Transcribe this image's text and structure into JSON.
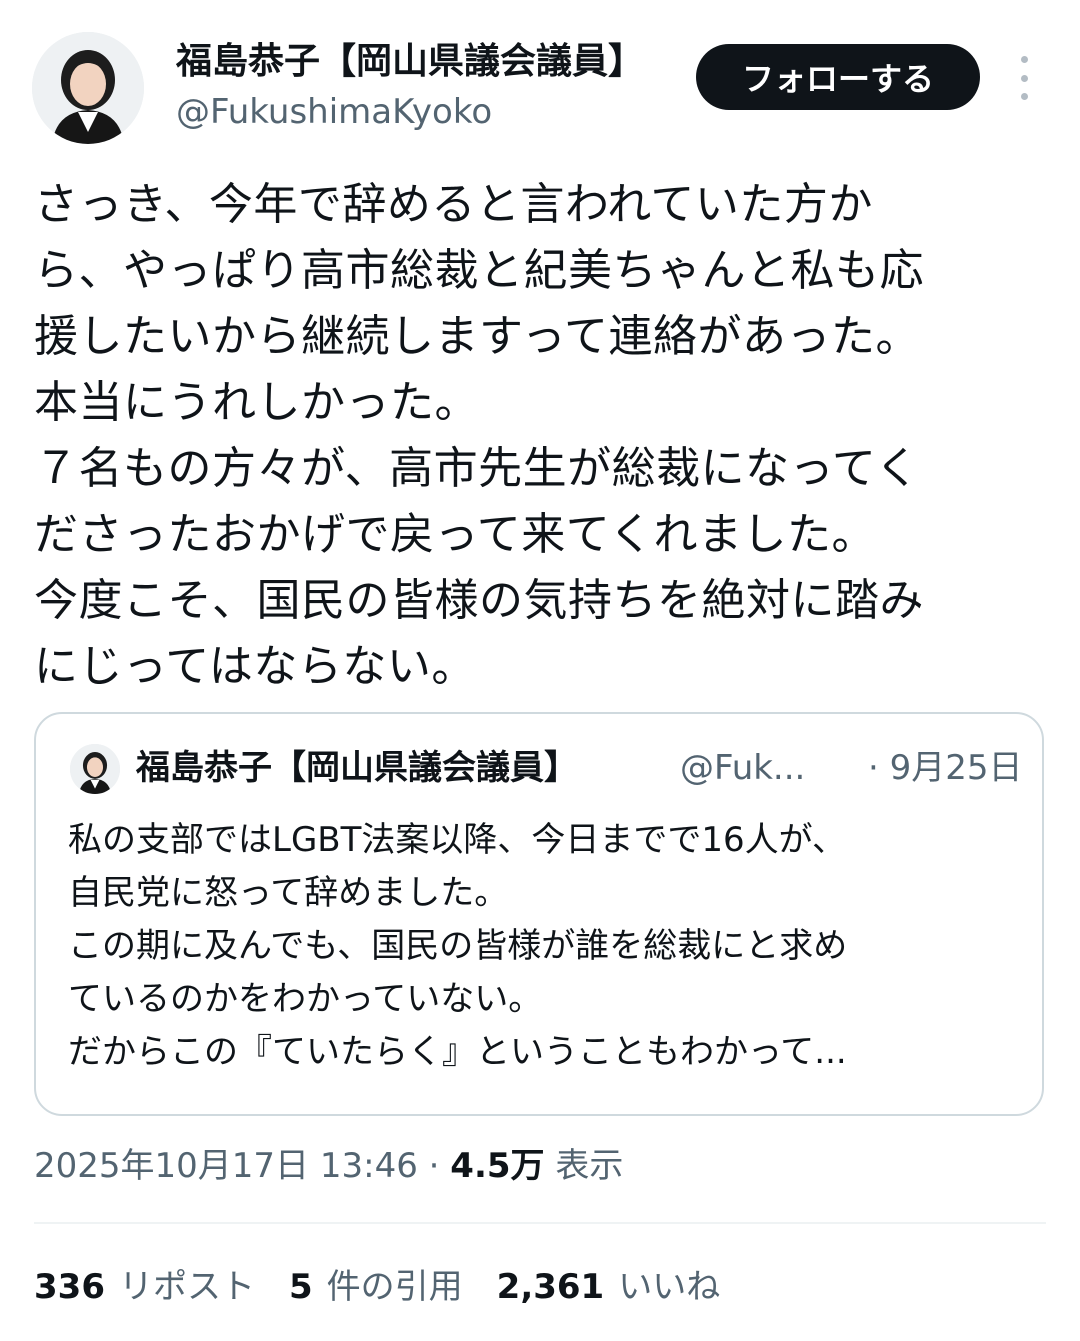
{
  "author": {
    "display_name": "福島恭子【岡山県議会議員】",
    "handle": "@FukushimaKyoko",
    "avatar_icon": "profile-photo"
  },
  "follow_label": "フォローする",
  "more_icon": "more-vertical-icon",
  "tweet_lines": [
    "さっき、今年で辞めると言われていた方か",
    "ら、やっぱり高市総裁と紀美ちゃんと私も応",
    "援したいから継続しますって連絡があった。",
    "本当にうれしかった。",
    "７名もの方々が、高市先生が総裁になってく",
    "ださったおかげで戻って来てくれました。",
    "今度こそ、国民の皆様の気持ちを絶対に踏み",
    "にじってはならない。"
  ],
  "quote": {
    "display_name": "福島恭子【岡山県議会議員】",
    "handle": "@Fuk...",
    "date": "· 9月25日",
    "lines": [
      "私の支部ではLGBT法案以降、今日までで16人が、",
      "自民党に怒って辞めました。",
      "この期に及んでも、国民の皆様が誰を総裁にと求め",
      "ているのかをわかっていない。",
      "だからこの『ていたらく』ということもわかって..."
    ]
  },
  "meta": {
    "timestamp": "2025年10月17日 13:46 · ",
    "views_count": "4.5万",
    "views_label": " 表示"
  },
  "stats": {
    "reposts_count": "336",
    "reposts_label": "リポスト",
    "quotes_count": "5",
    "quotes_label": "件の引用",
    "likes_count": "2,361",
    "likes_label": "いいね"
  },
  "colors": {
    "text_primary": "#0f1419",
    "text_secondary": "#536471",
    "border": "#cfd9de",
    "button_bg": "#0f1419"
  }
}
